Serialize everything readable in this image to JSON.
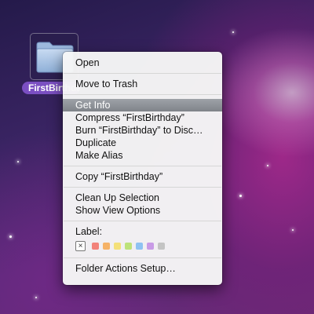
{
  "desktop_item": {
    "label": "FirstBirthday",
    "icon": "folder-icon"
  },
  "context_menu": {
    "group1": [
      "Open"
    ],
    "group2": [
      "Move to Trash"
    ],
    "group3": [
      "Get Info",
      "Compress “FirstBirthday”",
      "Burn “FirstBirthday” to Disc…",
      "Duplicate",
      "Make Alias"
    ],
    "group4": [
      "Copy “FirstBirthday”"
    ],
    "group5": [
      "Clean Up Selection",
      "Show View Options"
    ],
    "label_title": "Label:",
    "label_none_symbol": "×",
    "label_colors": [
      "#f2827a",
      "#f5b267",
      "#f4e07a",
      "#bde27b",
      "#8fc2f2",
      "#c99be6",
      "#c4c4c4"
    ],
    "group6": [
      "Folder Actions Setup…"
    ],
    "highlighted_item": "Get Info"
  }
}
